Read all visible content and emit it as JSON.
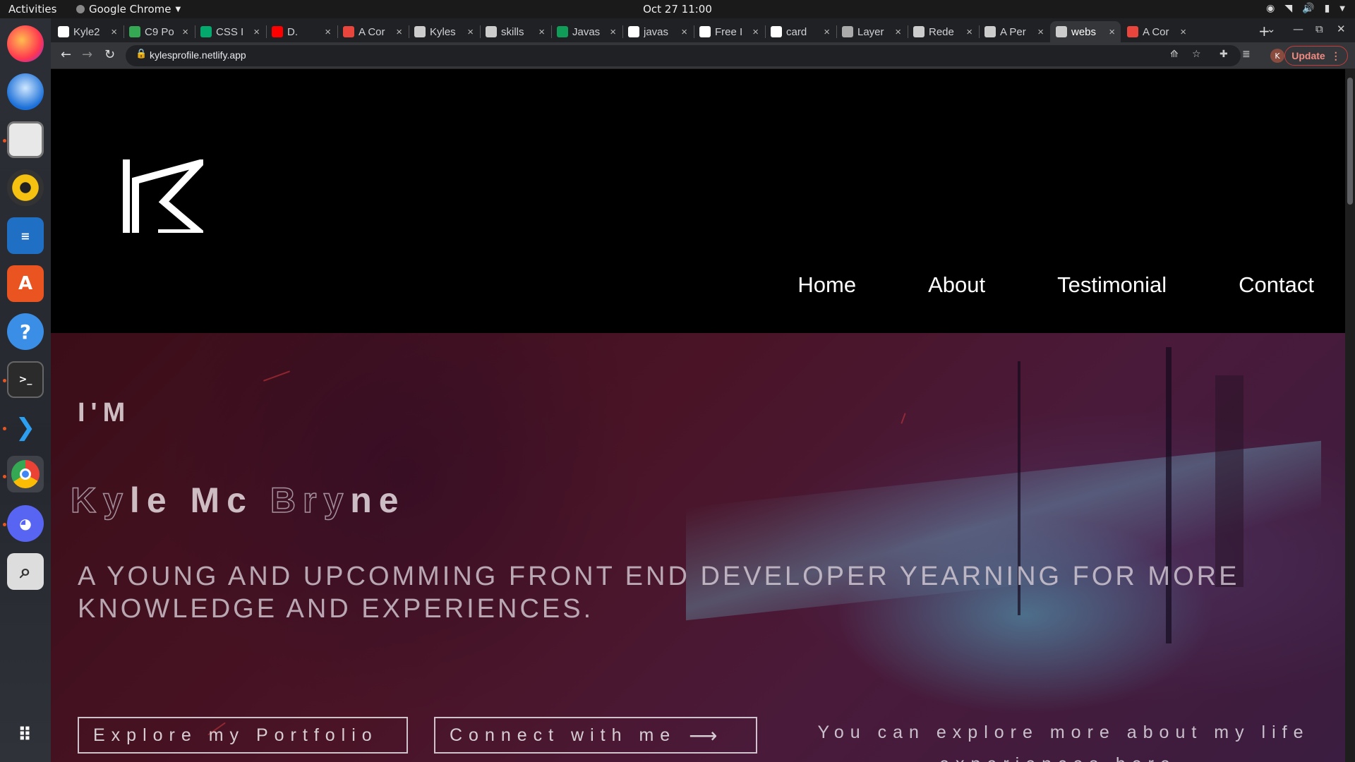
{
  "topbar": {
    "activities": "Activities",
    "app_name": "Google Chrome",
    "clock": "Oct 27  11:00"
  },
  "dock": {
    "apps": [
      "Firefox",
      "Thunderbird",
      "Files",
      "Rhythmbox",
      "LibreOffice Writer",
      "Ubuntu Software",
      "Help",
      "Terminal",
      "Visual Studio Code",
      "Google Chrome",
      "Discord",
      "Screenshot",
      "Show Applications"
    ]
  },
  "tabs": [
    {
      "title": "Kyle2",
      "icon": "github-icon",
      "color": "#ffffff"
    },
    {
      "title": "C9 Po",
      "icon": "drive-icon",
      "color": "#34a853"
    },
    {
      "title": "CSS I",
      "icon": "w3-icon",
      "color": "#04aa6d"
    },
    {
      "title": "D.",
      "icon": "youtube-icon",
      "color": "#ff0000"
    },
    {
      "title": "A Cor",
      "icon": "star-icon",
      "color": "#e8453c"
    },
    {
      "title": "Kyles",
      "icon": "netlify-icon",
      "color": "#cccccc"
    },
    {
      "title": "skills",
      "icon": "netlify-icon",
      "color": "#cccccc"
    },
    {
      "title": "Javas",
      "icon": "sheet-icon",
      "color": "#0f9d58"
    },
    {
      "title": "javas",
      "icon": "google-icon",
      "color": "#ffffff"
    },
    {
      "title": "Free I",
      "icon": "unsplash-icon",
      "color": "#ffffff"
    },
    {
      "title": "card",
      "icon": "google-icon",
      "color": "#ffffff"
    },
    {
      "title": "Layer",
      "icon": "layer-icon",
      "color": "#aaaaaa"
    },
    {
      "title": "Rede",
      "icon": "circle-icon",
      "color": "#cccccc"
    },
    {
      "title": "A Per",
      "icon": "netlify-icon",
      "color": "#cccccc"
    },
    {
      "title": "webs",
      "icon": "page-icon",
      "color": "#cccccc",
      "active": true
    },
    {
      "title": "A Cor",
      "icon": "star-icon",
      "color": "#e8453c"
    }
  ],
  "toolbar": {
    "url": "kylesprofile.netlify.app",
    "update_label": "Update",
    "profile_initial": "K"
  },
  "site": {
    "logo_letter": "K",
    "nav": [
      "Home",
      "About",
      "Testimonial",
      "Contact"
    ],
    "hero": {
      "intro": "I'M",
      "name_parts": [
        {
          "t": "K",
          "outline": true
        },
        {
          "t": "y",
          "outline": true
        },
        {
          "t": "le Mc ",
          "outline": false
        },
        {
          "t": "Bry",
          "outline": true
        },
        {
          "t": "ne",
          "outline": false
        }
      ],
      "tagline": "A YOUNG AND UPCOMMING FRONT END DEVELOPER YEARNING FOR MORE KNOWLEDGE AND EXPERIENCES.",
      "explore_button": "Explore my Portfolio",
      "connect_button": "Connect with me",
      "connect_arrow": "⟶",
      "explore_note": "You can explore more about my life experiences here."
    }
  },
  "colors": {
    "accent_update": "#f28b82",
    "header_bg": "#000000",
    "hero_tint": "#4a1426"
  }
}
